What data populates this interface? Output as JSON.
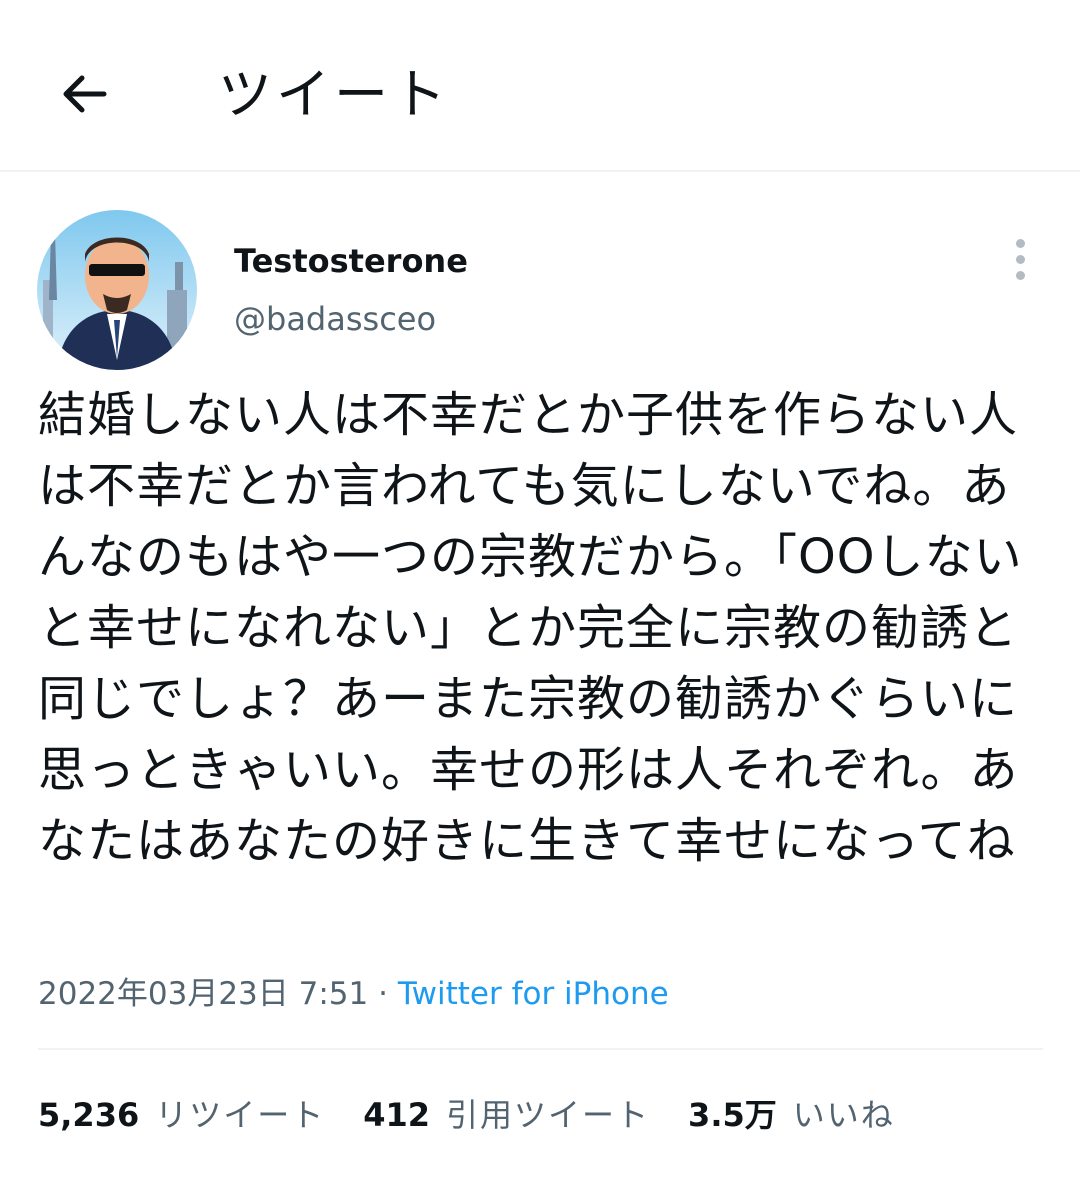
{
  "header": {
    "title": "ツイート"
  },
  "tweet": {
    "author": {
      "name": "Testosterone",
      "handle": "@badassceo"
    },
    "text": "結婚しない人は不幸だとか子供を作らない人は不幸だとか言われても気にしないでね。あんなのもはや一つの宗教だから。「OOしないと幸せになれない」とか完全に宗教の勧誘と同じでしょ？あーまた宗教の勧誘かぐらいに思っときゃいい。幸せの形は人それぞれ。あなたはあなたの好きに生きて幸せになってね",
    "timestamp": "2022年03月23日 7:51",
    "separator": " · ",
    "source": "Twitter for iPhone",
    "stats": {
      "retweets": {
        "count": "5,236",
        "label": "リツイート"
      },
      "quotes": {
        "count": "412",
        "label": "引用ツイート"
      },
      "likes": {
        "count": "3.5万",
        "label": "いいね"
      }
    }
  },
  "icons": {
    "back": "back-arrow-icon",
    "more": "more-vertical-icon"
  },
  "colors": {
    "text": "#0f1419",
    "secondary": "#536471",
    "link": "#1d9bf0",
    "divider": "#eff3f4"
  }
}
